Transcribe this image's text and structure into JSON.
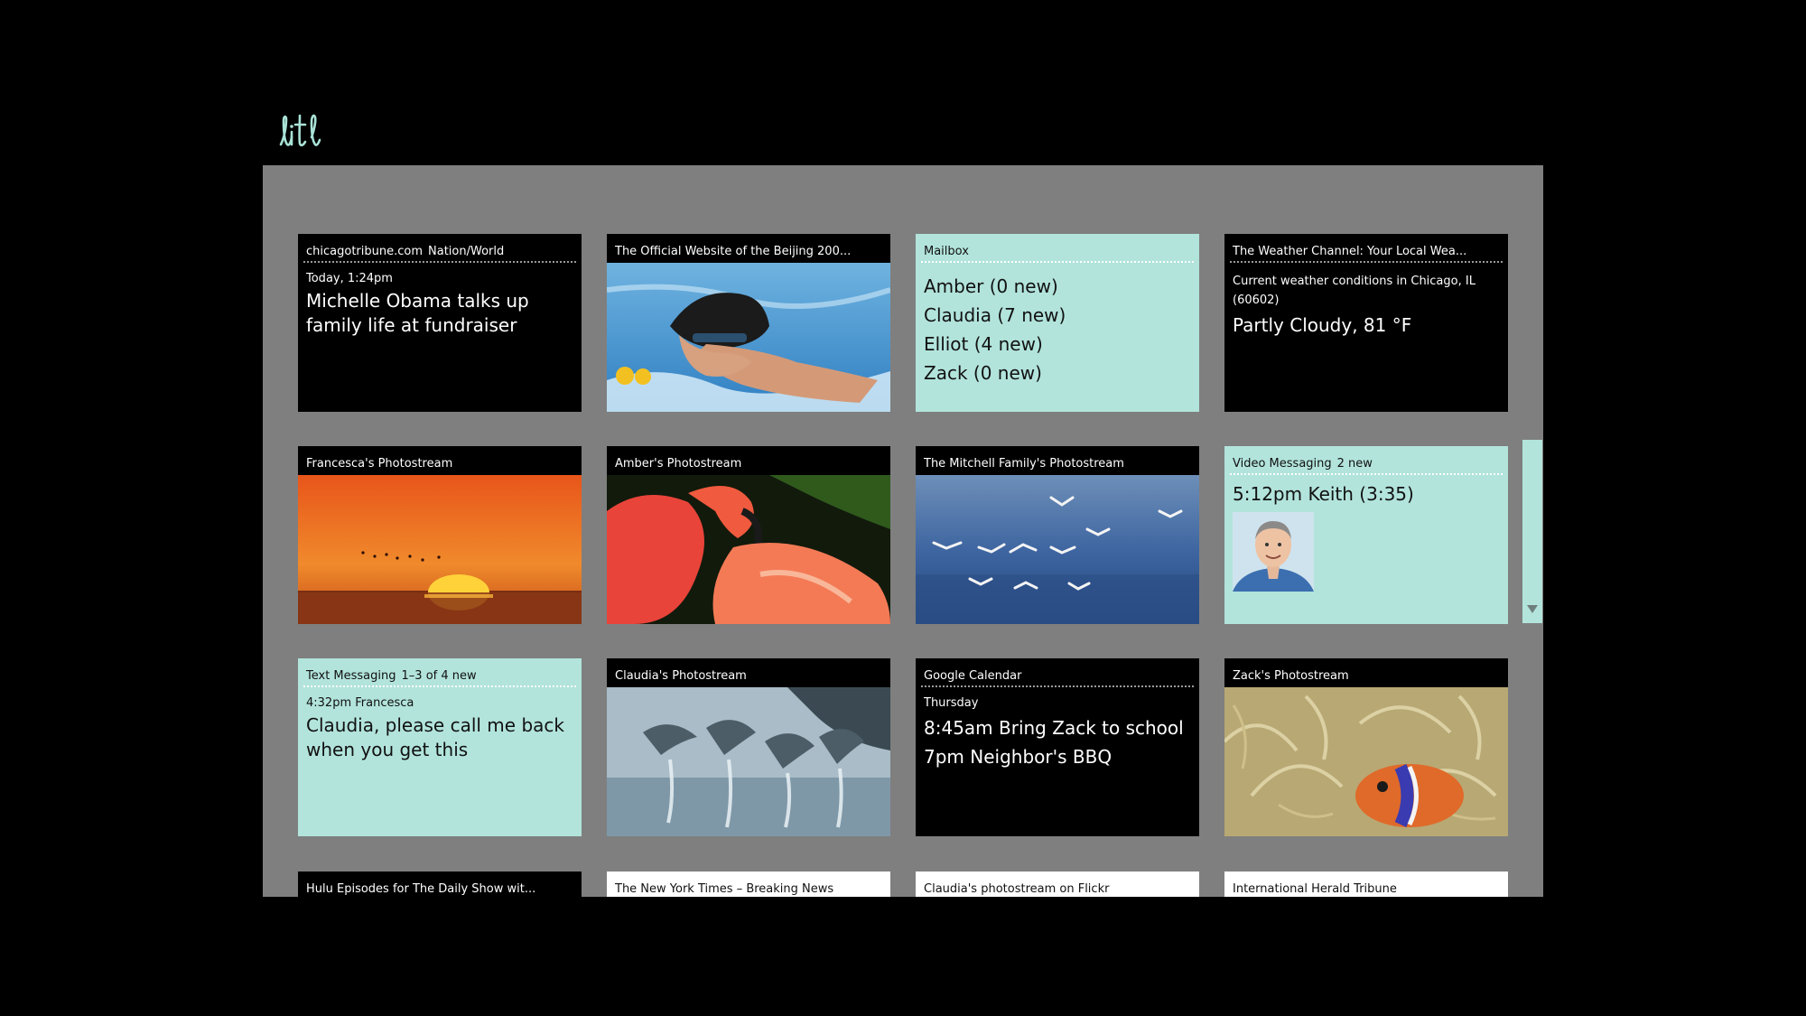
{
  "app": {
    "logo_icon": "litl-logo"
  },
  "tiles": {
    "news": {
      "source": "chicagotribune.com",
      "section": "Nation/World",
      "time": "Today, 1:24pm",
      "headline": "Michelle Obama talks up family life at fundraiser"
    },
    "beijing": {
      "title": "The Official Website of the Beijing 200..."
    },
    "mailbox": {
      "title": "Mailbox",
      "items": [
        "Amber (0 new)",
        "Claudia (7 new)",
        "Elliot (4 new)",
        "Zack (0 new)"
      ]
    },
    "weather": {
      "title": "The Weather Channel: Your Local Wea...",
      "location_line1": "Current weather conditions in Chicago, IL",
      "location_line2": "(60602)",
      "conditions": "Partly Cloudy, 81 °F"
    },
    "francesca": {
      "title": "Francesca's Photostream"
    },
    "amber": {
      "title": "Amber's Photostream"
    },
    "mitchell": {
      "title": "The Mitchell Family's Photostream"
    },
    "video": {
      "title": "Video Messaging",
      "count": "2 new",
      "message": "5:12pm  Keith (3:35)"
    },
    "text": {
      "title": "Text Messaging",
      "count": "1–3 of 4 new",
      "meta": "4:32pm  Francesca",
      "message": "Claudia, please call me back when you get this"
    },
    "claudia": {
      "title": "Claudia's Photostream"
    },
    "calendar": {
      "title": "Google Calendar",
      "day": "Thursday",
      "events": [
        "8:45am  Bring Zack to school",
        "7pm  Neighbor's BBQ"
      ]
    },
    "zack": {
      "title": "Zack's Photostream"
    },
    "hulu": {
      "title": "Hulu  Episodes for The Daily Show wit..."
    },
    "nyt": {
      "title": "The New York Times – Breaking News"
    },
    "flickr": {
      "title": "Claudia's photostream on Flickr"
    },
    "iht": {
      "title": "International Herald Tribune"
    }
  }
}
